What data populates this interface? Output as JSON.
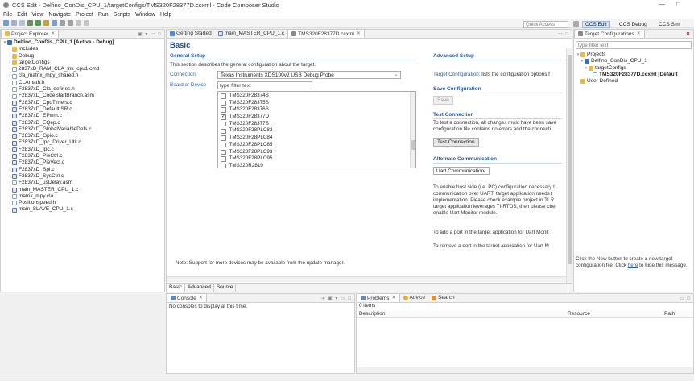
{
  "window": {
    "title": "CCS Edit - Delfino_ConDis_CPU_1/targetConfigs/TMS320F28377D.ccxml - Code Composer Studio",
    "minimize": "—",
    "maximize": "□"
  },
  "menu": [
    "File",
    "Edit",
    "View",
    "Navigate",
    "Project",
    "Run",
    "Scripts",
    "Window",
    "Help"
  ],
  "toolbar": {
    "quick_access": "Quick Access",
    "perspectives": [
      "CCS Edit",
      "CCS Debug",
      "CCS Sim"
    ]
  },
  "project_explorer": {
    "tab": "Project Explorer",
    "root": "Delfino_ConDis_CPU_1  [Active - Debug]",
    "items": [
      {
        "label": "Includes",
        "icon": "folder"
      },
      {
        "label": "Debug",
        "icon": "folder"
      },
      {
        "label": "targetConfigs",
        "icon": "folder"
      },
      {
        "label": "2837xD_RAM_CLA_lnk_cpu1.cmd",
        "icon": "file"
      },
      {
        "label": "cla_matrix_mpy_shared.h",
        "icon": "file"
      },
      {
        "label": "CLAmath.h",
        "icon": "file"
      },
      {
        "label": "F2837xD_Cla_defines.h",
        "icon": "file"
      },
      {
        "label": "F2837xD_CodeStartBranch.asm",
        "icon": "file"
      },
      {
        "label": "F2837xD_CpuTimers.c",
        "icon": "csrc"
      },
      {
        "label": "F2837xD_DefaultISR.c",
        "icon": "csrc"
      },
      {
        "label": "F2837xD_EPwm.c",
        "icon": "csrc"
      },
      {
        "label": "F2837xD_EQep.c",
        "icon": "csrc"
      },
      {
        "label": "F2837xD_GlobalVariableDefs.c",
        "icon": "csrc"
      },
      {
        "label": "F2837xD_Gpio.c",
        "icon": "csrc"
      },
      {
        "label": "F2837xD_Ipc_Driver_Util.c",
        "icon": "csrc"
      },
      {
        "label": "F2837xD_Ipc.c",
        "icon": "csrc"
      },
      {
        "label": "F2837xD_PieCtrl.c",
        "icon": "csrc"
      },
      {
        "label": "F2837xD_PieVect.c",
        "icon": "csrc"
      },
      {
        "label": "F2837xD_Spi.c",
        "icon": "csrc"
      },
      {
        "label": "F2837xD_SysCtrl.c",
        "icon": "csrc"
      },
      {
        "label": "F2837xD_usDelay.asm",
        "icon": "file"
      },
      {
        "label": "main_MASTER_CPU_1.c",
        "icon": "csrc"
      },
      {
        "label": "matrix_mpy.cla",
        "icon": "file"
      },
      {
        "label": "Positionspeed.h",
        "icon": "file"
      },
      {
        "label": "main_SLAVE_CPU_1.c",
        "icon": "csrc"
      }
    ]
  },
  "editor": {
    "tabs": [
      "Getting Started",
      "main_MASTER_CPU_1.c",
      "TMS320F28377D.ccxml"
    ],
    "heading": "Basic",
    "general_setup": {
      "title": "General Setup",
      "description": "This section describes the general configuration about the target.",
      "connection_label": "Connection",
      "connection_value": "Texas Instruments XDS100v2 USB Debug Probe",
      "board_label": "Board or Device",
      "filter_placeholder": "type filter text",
      "devices": [
        {
          "name": "TMS320F28374S",
          "checked": false
        },
        {
          "name": "TMS320F28375S",
          "checked": false
        },
        {
          "name": "TMS320F28376S",
          "checked": false
        },
        {
          "name": "TMS320F28377D",
          "checked": true
        },
        {
          "name": "TMS320F28377S",
          "checked": false
        },
        {
          "name": "TMS320F28PLC83",
          "checked": false
        },
        {
          "name": "TMS320F28PLC84",
          "checked": false
        },
        {
          "name": "TMS320F28PLC85",
          "checked": false
        },
        {
          "name": "TMS320F28PLC93",
          "checked": false
        },
        {
          "name": "TMS320F28PLC95",
          "checked": false
        },
        {
          "name": "TMS320R2810",
          "checked": false
        }
      ],
      "note": "Note: Support for more devices may be available from the update manager."
    },
    "advanced_setup": {
      "title": "Advanced Setup",
      "link": "Target Configuration",
      "link_suffix": ": lists the configuration options f"
    },
    "save_config": {
      "title": "Save Configuration",
      "button": "Save"
    },
    "test_connection": {
      "title": "Test Connection",
      "line1": "To test a connection, all changes must have been save",
      "line2": "configuration file contains no errors and the connecti",
      "button": "Test Connection"
    },
    "alt_comm": {
      "title": "Alternate Communication",
      "select": "Uart Communication",
      "lines": [
        "To enable host side (i.e. PC) configuration necessary t",
        "communication over UART, target application needs t",
        "implementation. Please check example project in TI R",
        "target application leverages TI-RTOS, then please che",
        "enable Uart Monitor module."
      ],
      "add_port": "To add a port in the target application for Uart Monit",
      "remove_port": "To remove a port in the target application for Uart M"
    },
    "bottom_tabs": [
      "Basic",
      "Advanced",
      "Source"
    ]
  },
  "target_configs": {
    "tab": "Target Configurations",
    "filter_placeholder": "type filter text",
    "tree": [
      {
        "label": "Projects",
        "level": 0,
        "icon": "folder",
        "bold": false
      },
      {
        "label": "Delfino_ConDis_CPU_1",
        "level": 1,
        "icon": "proj",
        "bold": false
      },
      {
        "label": "targetConfigs",
        "level": 2,
        "icon": "folder",
        "bold": false
      },
      {
        "label": "TMS320F28377D.ccxml [Default",
        "level": 3,
        "icon": "file",
        "bold": true
      },
      {
        "label": "User Defined",
        "level": 0,
        "icon": "folder",
        "bold": false
      }
    ],
    "hint_line1": "Click the New button to create a new target",
    "hint_pre": "configuration file. Click ",
    "hint_link": "here",
    "hint_post": " to hide this message."
  },
  "console": {
    "tab": "Console",
    "message": "No consoles to display at this time."
  },
  "problems": {
    "tabs": [
      "Problems",
      "Advice",
      "Search"
    ],
    "count": "0 items",
    "columns": [
      "Description",
      "Resource",
      "Path"
    ]
  }
}
